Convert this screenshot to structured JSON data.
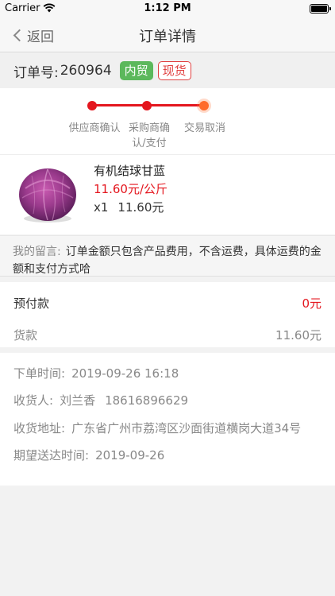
{
  "status_bar": {
    "carrier": "Carrier",
    "time": "1:12 PM"
  },
  "nav": {
    "back_label": "返回",
    "title": "订单详情"
  },
  "order": {
    "number_label": "订单号:",
    "number": "260964",
    "tags": [
      "内贸",
      "现货"
    ],
    "tag_colors": {
      "domestic": "#5cb85c",
      "spot": "#e04040"
    }
  },
  "progress": {
    "accent_color": "#e4161e",
    "current_color": "#ff6a2a",
    "steps": [
      {
        "label": "供应商确认"
      },
      {
        "label_line1": "采购商确",
        "label_line2": "认/支付"
      },
      {
        "label": "交易取消"
      }
    ]
  },
  "product": {
    "name": "有机结球甘蓝",
    "price": "11.60元/公斤",
    "quantity": "x1",
    "subtotal": "11.60元",
    "image": "purple-cabbage"
  },
  "message": {
    "label": "我的留言:",
    "text": "订单金额只包含产品费用，不含运费，具体运费的金额和支付方式哈"
  },
  "payment": {
    "prepay_label": "预付款",
    "prepay_value": "0元",
    "goods_label": "货款",
    "goods_value": "11.60元"
  },
  "info": {
    "order_time_label": "下单时间:",
    "order_time": "2019-09-26 16:18",
    "receiver_label": "收货人:",
    "receiver_name": "刘兰香",
    "receiver_phone": "18616896629",
    "address_label": "收货地址:",
    "address": "广东省广州市荔湾区沙面街道横岗大道34号",
    "expected_label": "期望送达时间:",
    "expected_date": "2019-09-26"
  }
}
